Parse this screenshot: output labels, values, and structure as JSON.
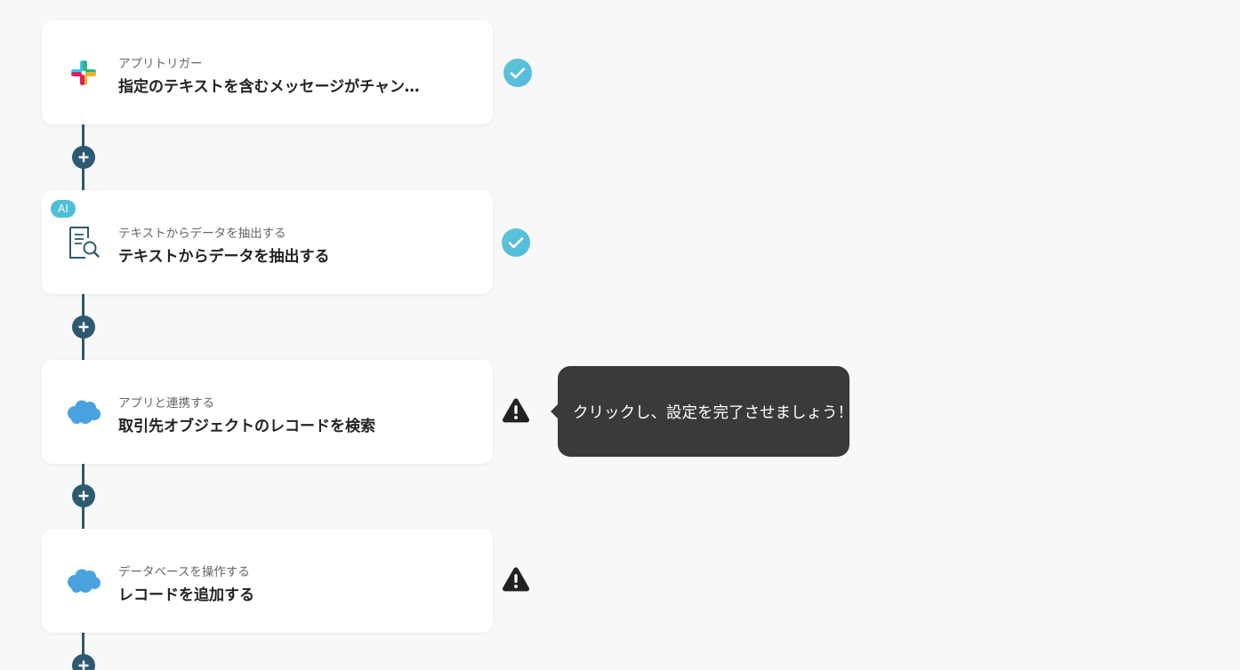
{
  "steps": [
    {
      "category": "アプリトリガー",
      "title": "指定のテキストを含むメッセージがチャンネルに投稿されたら",
      "app_icon": "slack-icon",
      "badge": null,
      "status": "complete"
    },
    {
      "category": "テキストからデータを抽出する",
      "title": "テキストからデータを抽出する",
      "app_icon": "document-search-icon",
      "badge": "AI",
      "status": "complete"
    },
    {
      "category": "アプリと連携する",
      "title": "取引先オブジェクトのレコードを検索",
      "app_icon": "salesforce-icon",
      "badge": null,
      "status": "warning"
    },
    {
      "category": "データベースを操作する",
      "title": "レコードを追加する",
      "app_icon": "salesforce-icon",
      "badge": null,
      "status": "warning"
    }
  ],
  "tooltip": {
    "text": "クリックし、設定を完了させましょう！"
  },
  "colors": {
    "connector": "#2d5a70",
    "check_gradient_start": "#5cc6d6",
    "check_gradient_end": "#55b8e0",
    "warning": "#222222",
    "tooltip_bg": "#3a3a3a",
    "ai_badge": "#4fbfd5",
    "salesforce": "#4aa3df"
  }
}
